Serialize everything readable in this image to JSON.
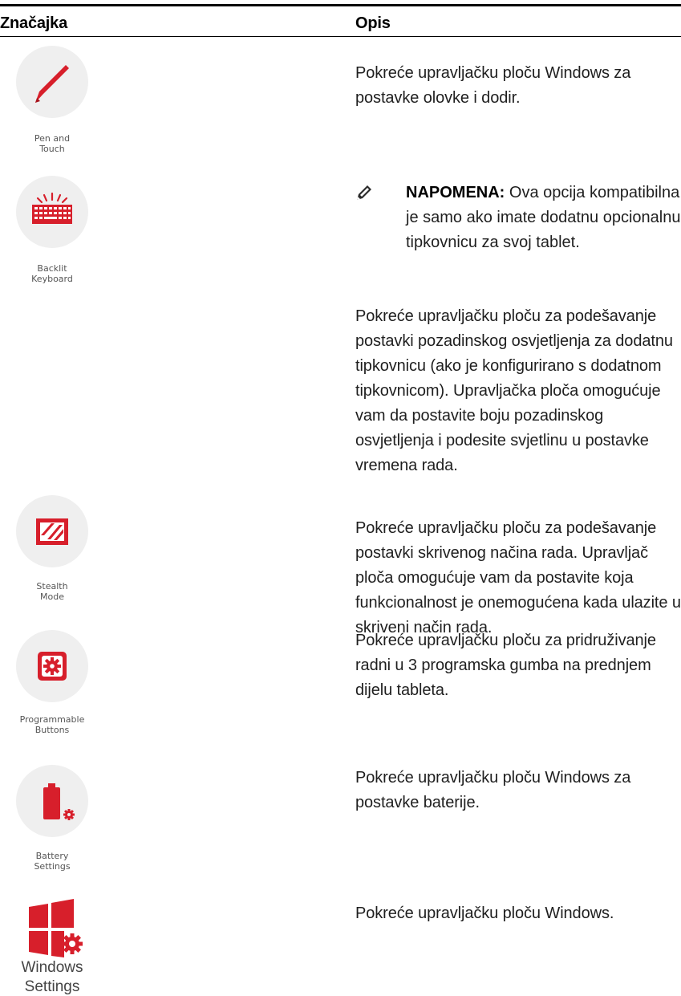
{
  "table": {
    "header_feature": "Značajka",
    "header_description": "Opis"
  },
  "features": [
    {
      "name": "pen-and-touch",
      "caption_line1": "Pen and",
      "caption_line2": "Touch",
      "icon": "pen-icon",
      "description": "Pokreće upravljačku ploču Windows za postavke olovke i dodir."
    },
    {
      "name": "backlit-keyboard",
      "caption_line1": "Backlit",
      "caption_line2": "Keyboard",
      "icon": "backlit-keyboard-icon",
      "description": "Pokreće upravljačku ploču za podešavanje postavki pozadinskog osvjetljenja za dodatnu tipkovnicu (ako je konfigurirano s dodatnom tipkovnicom). Upravljačka ploča omogućuje vam da postavite boju pozadinskog osvjetljenja i podesite svjetlinu u postavke vremena rada."
    },
    {
      "name": "stealth-mode",
      "caption_line1": "Stealth",
      "caption_line2": "Mode",
      "icon": "stealth-mode-icon",
      "description": "Pokreće upravljačku ploču za podešavanje postavki skrivenog načina rada. Upravljač ploča omogućuje vam da postavite koja funkcionalnost je onemogućena kada ulazite u skriveni način rada."
    },
    {
      "name": "programmable-buttons",
      "caption_line1": "Programmable",
      "caption_line2": "Buttons",
      "icon": "programmable-buttons-icon",
      "description": "Pokreće upravljačku ploču za pridruživanje radni u 3 programska gumba na prednjem dijelu tableta."
    },
    {
      "name": "battery-settings",
      "caption_line1": "Battery",
      "caption_line2": "Settings",
      "icon": "battery-icon",
      "description": "Pokreće upravljačku ploču Windows za postavke baterije."
    },
    {
      "name": "windows-settings",
      "caption_line1": "Windows",
      "caption_line2": "Settings",
      "icon": "windows-settings-icon",
      "description": "Pokreće upravljačku ploču Windows."
    }
  ],
  "note": {
    "label": "NAPOMENA:",
    "text": "Ova opcija kompatibilna je samo ako imate dodatnu opcionalnu tipkovnicu za svoj tablet.",
    "icon": "note-pencil-icon"
  },
  "colors": {
    "accent_red": "#d71f2b",
    "tile_gray": "#efefef"
  }
}
